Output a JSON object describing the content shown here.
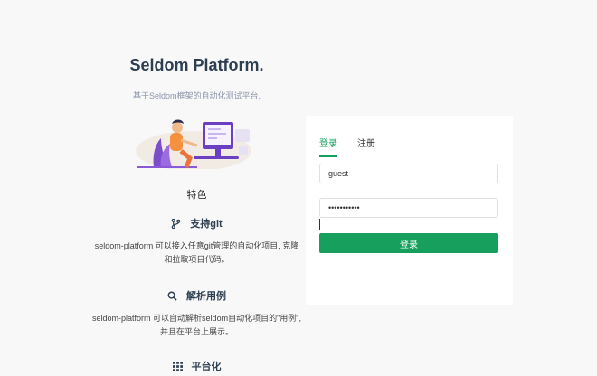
{
  "brand": {
    "title": "Seldom Platform.",
    "subtitle": "基于Seldom框架的自动化测试平台."
  },
  "features": {
    "title": "特色",
    "items": [
      {
        "icon": "git-branch-icon",
        "title": "支持git",
        "desc": "seldom-platform 可以接入任意git管理的自动化项目, 克隆和拉取项目代码。"
      },
      {
        "icon": "search-icon",
        "title": "解析用例",
        "desc": "seldom-platform 可以自动解析seldom自动化项目的\"用例\", 并且在平台上展示。"
      },
      {
        "icon": "grid-icon",
        "title": "平台化",
        "desc": ""
      }
    ]
  },
  "login": {
    "tabs": [
      {
        "label": "登录",
        "active": true
      },
      {
        "label": "注册",
        "active": false
      }
    ],
    "username_value": "guest",
    "password_value": "guest123456",
    "submit_label": "登录",
    "accent_color": "#17a05d"
  }
}
